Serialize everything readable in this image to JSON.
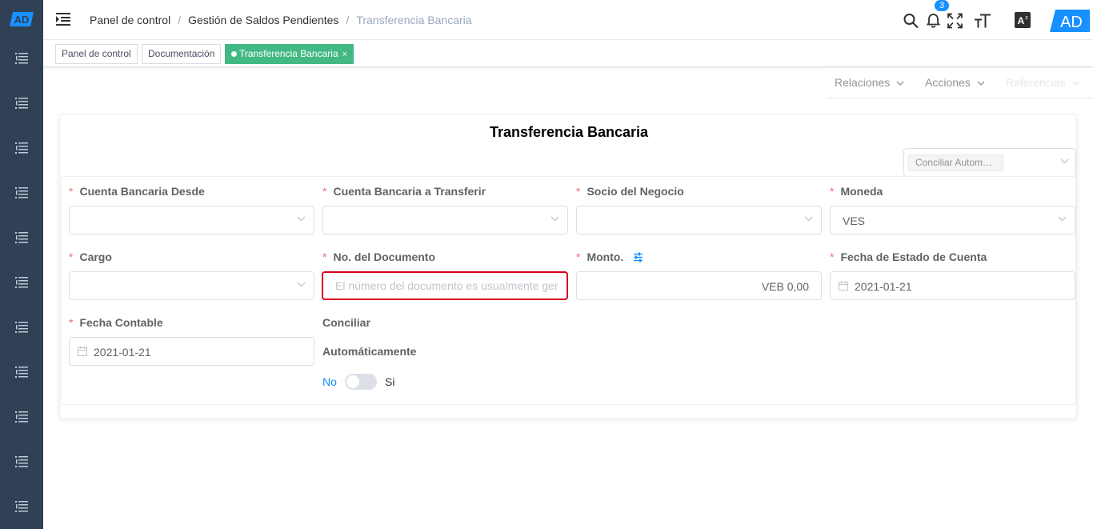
{
  "app": {
    "logo_text": "AD",
    "avatar_text": "AD"
  },
  "breadcrumb": [
    "Panel de control",
    "Gestión de Saldos Pendientes",
    "Transferencia Bancaria"
  ],
  "notifications": {
    "count": "3"
  },
  "tags": [
    {
      "label": "Panel de control"
    },
    {
      "label": "Documentación"
    },
    {
      "label": "Transferencia Bancaria",
      "close": "×"
    }
  ],
  "menu": {
    "relations": "Relaciones",
    "actions": "Acciones",
    "references": "Referencias"
  },
  "form": {
    "title": "Transferencia Bancaria",
    "auto_select_chip": "Conciliar Autom…",
    "required_mark": "*",
    "fields": {
      "bank_from": {
        "label": "Cuenta Bancaria Desde",
        "value": ""
      },
      "bank_to": {
        "label": "Cuenta Bancaria a Transferir",
        "value": ""
      },
      "partner": {
        "label": "Socio del Negocio",
        "value": ""
      },
      "currency": {
        "label": "Moneda",
        "value": "VES"
      },
      "charge": {
        "label": "Cargo",
        "value": ""
      },
      "doc_no": {
        "label": "No. del Documento",
        "placeholder": "El número del documento es usualmente generado automáticamente",
        "value": ""
      },
      "amount": {
        "label": "Monto.",
        "value": "VEB 0,00"
      },
      "statement_date": {
        "label": "Fecha de Estado de Cuenta",
        "value": "2021-01-21"
      },
      "accounting_date": {
        "label": "Fecha Contable",
        "value": "2021-01-21"
      },
      "auto_reconcile": {
        "label_line1": "Conciliar",
        "label_line2": "Automáticamente",
        "off_label": "No",
        "on_label": "Si",
        "state": "off"
      }
    }
  },
  "colors": {
    "sidebar": "#304156",
    "accent": "#1890ff",
    "active_tag": "#42b983",
    "required": "#f56c6c",
    "error_border": "#d9001b"
  }
}
